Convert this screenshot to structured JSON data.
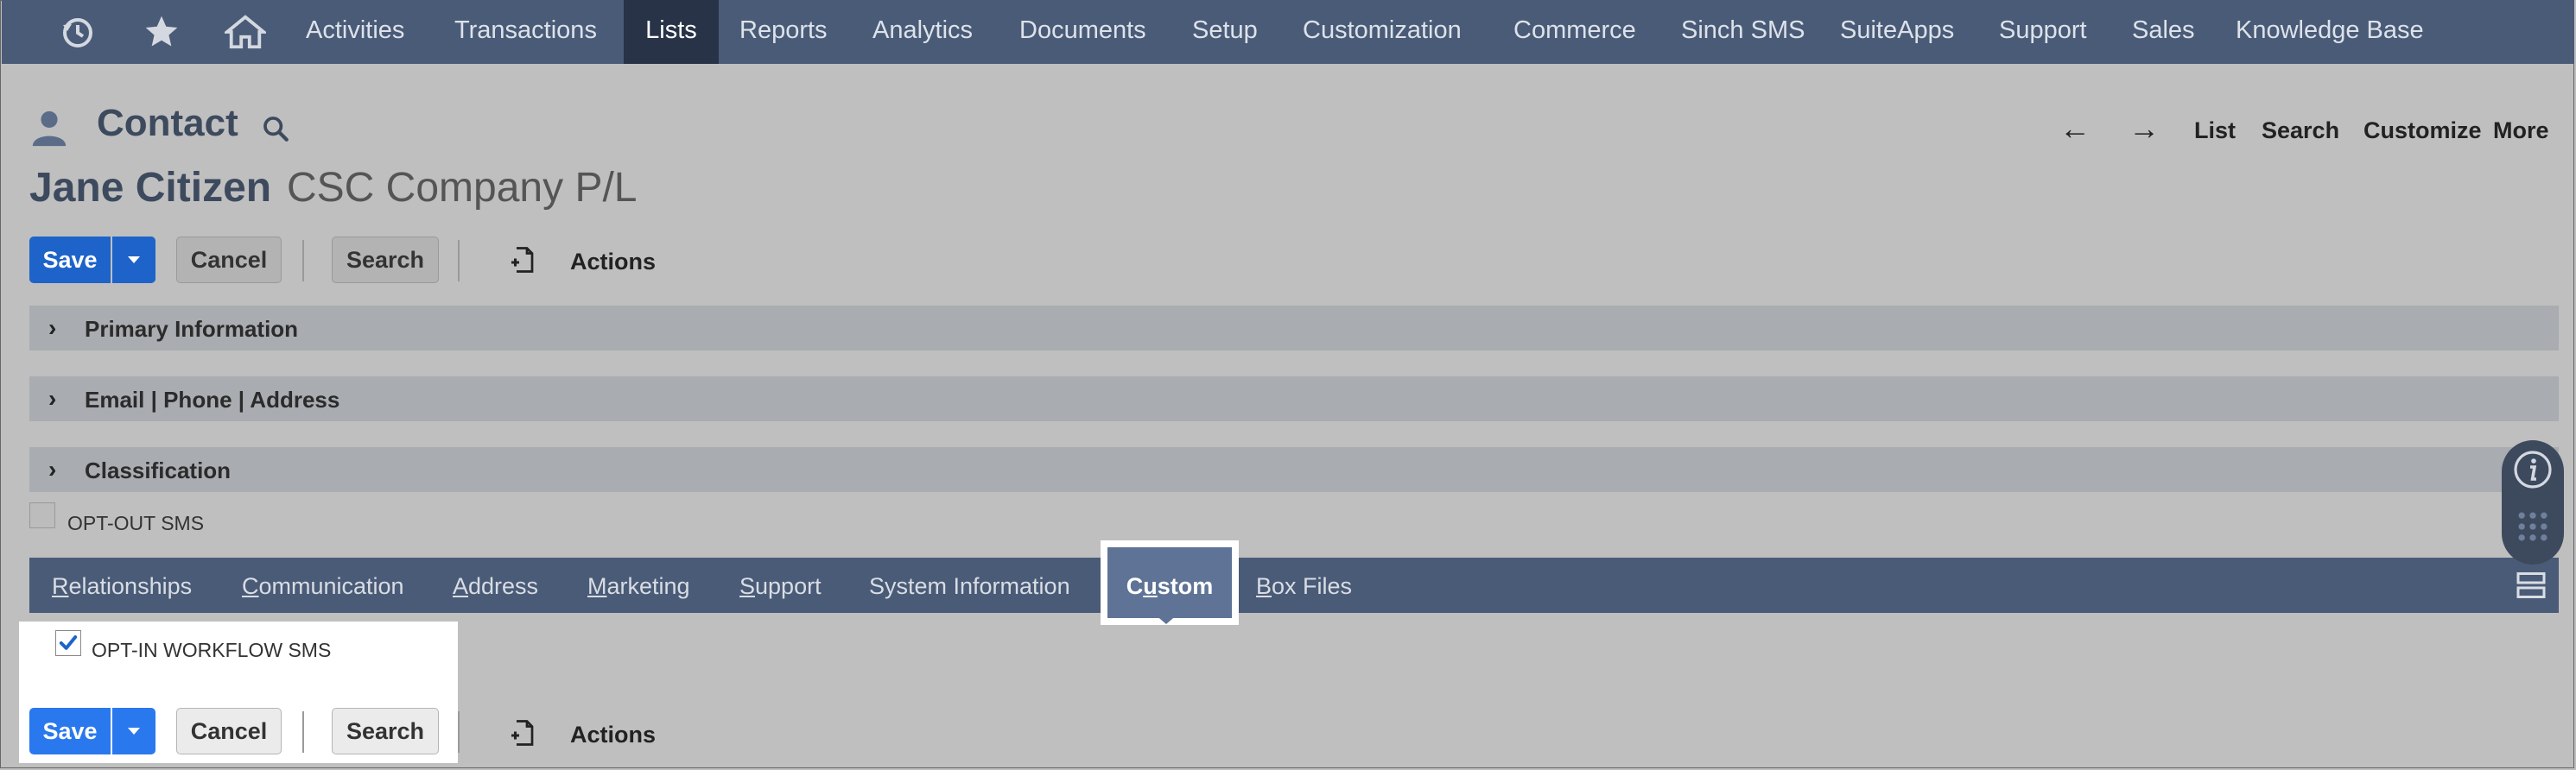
{
  "topnav": {
    "icons": [
      "recent-icon",
      "star-icon",
      "home-icon"
    ],
    "items": [
      "Activities",
      "Transactions",
      "Lists",
      "Reports",
      "Analytics",
      "Documents",
      "Setup",
      "Customization",
      "Commerce",
      "Sinch SMS",
      "SuiteApps",
      "Support",
      "Sales",
      "Knowledge Base"
    ],
    "active": "Lists"
  },
  "header": {
    "record_type": "Contact",
    "record_name": "Jane Citizen",
    "company": "CSC Company P/L",
    "links": [
      "List",
      "Search",
      "Customize",
      "More"
    ]
  },
  "buttons": {
    "save": "Save",
    "cancel": "Cancel",
    "search": "Search",
    "actions": "Actions"
  },
  "sections": [
    "Primary Information",
    "Email | Phone | Address",
    "Classification"
  ],
  "fields": {
    "opt_out_sms": "OPT-OUT SMS",
    "opt_out_sms_checked": false,
    "opt_in_workflow_sms": "OPT-IN WORKFLOW SMS",
    "opt_in_workflow_sms_checked": true
  },
  "tabs": {
    "items": [
      {
        "first": "R",
        "rest": "elationships"
      },
      {
        "first": "C",
        "rest": "ommunication"
      },
      {
        "first": "A",
        "rest": "ddress"
      },
      {
        "first": "M",
        "rest": "arketing"
      },
      {
        "first": "S",
        "rest": "upport"
      },
      {
        "first": "",
        "rest": "System Information"
      },
      {
        "first": "Cu",
        "rest": "stom"
      },
      {
        "first": "B",
        "rest": "ox Files"
      }
    ],
    "active": "Custom"
  },
  "colors": {
    "nav_bg": "#4a5b77",
    "nav_active": "#283347",
    "primary_button": "#1e63c9",
    "page_bg": "#bfbfbf"
  }
}
